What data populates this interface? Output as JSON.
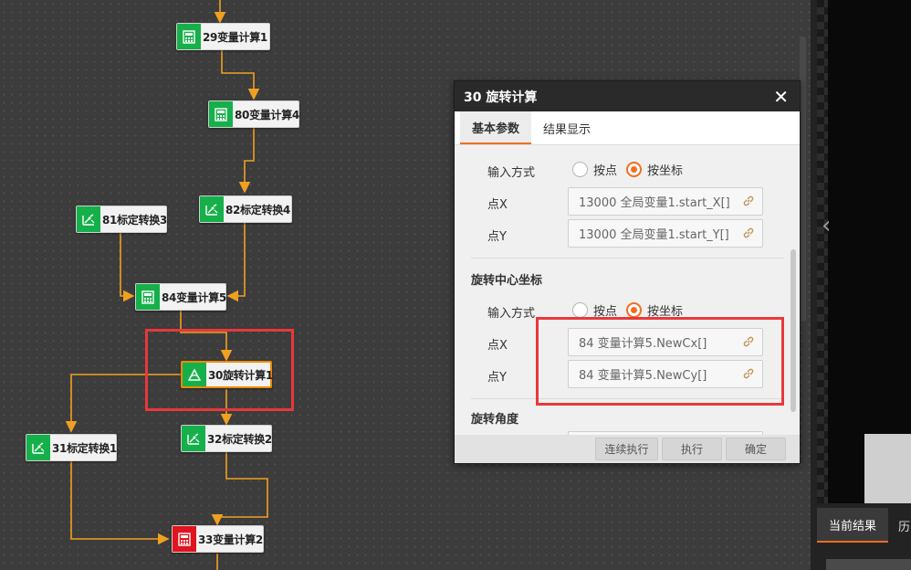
{
  "flow": {
    "nodes": [
      {
        "id": "n29",
        "label": "29变量计算1",
        "icon": "calculator-icon"
      },
      {
        "id": "n80",
        "label": "80变量计算4",
        "icon": "calculator-icon"
      },
      {
        "id": "n82",
        "label": "82标定转换4",
        "icon": "calibration-icon"
      },
      {
        "id": "n81",
        "label": "81标定转换3",
        "icon": "calibration-icon"
      },
      {
        "id": "n84",
        "label": "84变量计算5",
        "icon": "calculator-icon"
      },
      {
        "id": "n30",
        "label": "30旋转计算1",
        "icon": "rotate-icon",
        "state": "selected"
      },
      {
        "id": "n32",
        "label": "32标定转换2",
        "icon": "calibration-icon"
      },
      {
        "id": "n31",
        "label": "31标定转换1",
        "icon": "calibration-icon"
      },
      {
        "id": "n33",
        "label": "33变量计算2",
        "icon": "calculator-icon",
        "state": "error"
      }
    ]
  },
  "dialog": {
    "title": "30 旋转计算",
    "close_glyph": "✕",
    "tabs": [
      {
        "label": "基本参数",
        "active": true
      },
      {
        "label": "结果显示",
        "active": false
      }
    ],
    "point": {
      "input_mode_label": "输入方式",
      "option_point": "按点",
      "option_coord": "按坐标",
      "selected": "按坐标",
      "x_label": "点X",
      "x_value": "13000 全局变量1.start_X[]",
      "y_label": "点Y",
      "y_value": "13000 全局变量1.start_Y[]"
    },
    "center": {
      "section_title": "旋转中心坐标",
      "input_mode_label": "输入方式",
      "option_point": "按点",
      "option_coord": "按坐标",
      "selected": "按坐标",
      "x_label": "点X",
      "x_value": "84 变量计算5.NewCx[]",
      "y_label": "点Y",
      "y_value": "84 变量计算5.NewCy[]"
    },
    "angle_section_title": "旋转角度",
    "buttons": {
      "continuous": "连续执行",
      "run": "执行",
      "ok": "确定"
    }
  },
  "right_panel": {
    "tab_current": "当前结果",
    "tab_history": "历",
    "prev_glyph": "‹"
  },
  "colors": {
    "accent": "#f26d21",
    "node_icon_green": "#16b04a",
    "node_icon_red": "#e0141e",
    "wire": "#f0a020",
    "highlight": "#e8383b"
  }
}
